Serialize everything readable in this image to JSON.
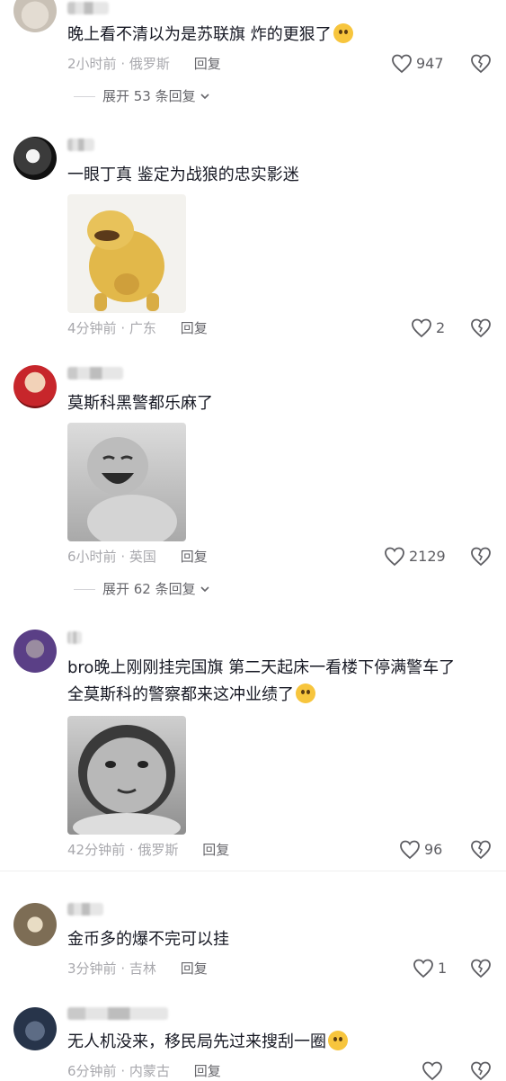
{
  "comments": [
    {
      "text": "晚上看不清以为是苏联旗 炸的更狠了",
      "time": "2小时前",
      "location": "俄罗斯",
      "reply_label": "回复",
      "likes": "947",
      "expand_label": "展开 53 条回复"
    },
    {
      "text": "一眼丁真 鉴定为战狼的忠实影迷",
      "time": "4分钟前",
      "location": "广东",
      "reply_label": "回复",
      "likes": "2"
    },
    {
      "text": "莫斯科黑警都乐麻了",
      "time": "6小时前",
      "location": "英国",
      "reply_label": "回复",
      "likes": "2129",
      "expand_label": "展开 62 条回复"
    },
    {
      "text": "bro晚上刚刚挂完国旗 第二天起床一看楼下停满警车了\n全莫斯科的警察都来这冲业绩了",
      "time": "42分钟前",
      "location": "俄罗斯",
      "reply_label": "回复",
      "likes": "96"
    },
    {
      "text": "金币多的爆不完可以挂",
      "time": "3分钟前",
      "location": "吉林",
      "reply_label": "回复",
      "likes": "1"
    },
    {
      "text": "无人机没来，移民局先过来搜刮一圈",
      "time": "6分钟前",
      "location": "内蒙古",
      "reply_label": "回复",
      "likes": ""
    }
  ],
  "separator": "·",
  "colors": {
    "meta": "#a8a8ad",
    "text": "#161823",
    "reply": "#66666b"
  },
  "icons": {
    "like": "heart-outline-icon",
    "dislike": "broken-heart-icon",
    "expand": "chevron-down-icon"
  }
}
